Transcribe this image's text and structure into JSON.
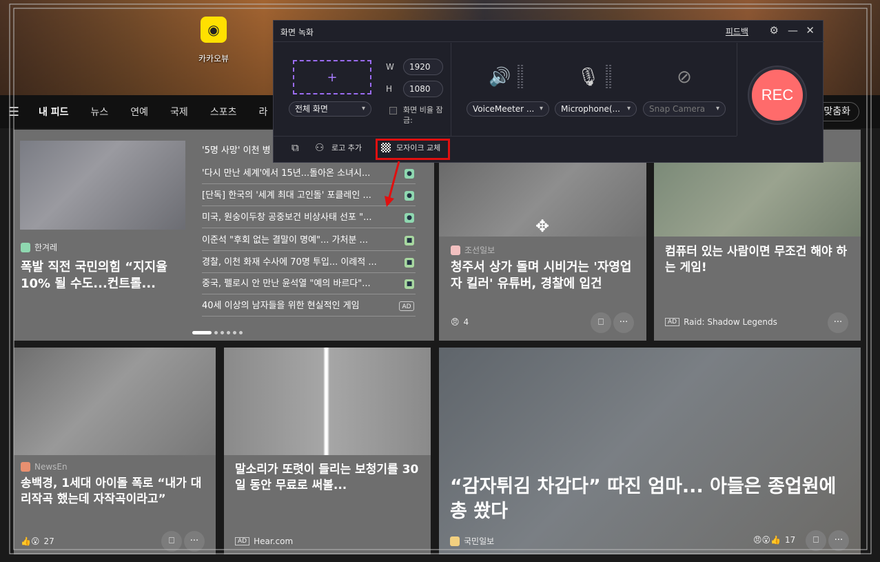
{
  "desktop": {
    "icons": [
      {
        "label": "카카오뷰"
      }
    ]
  },
  "nav": {
    "items": [
      "내 피드",
      "뉴스",
      "연예",
      "국제",
      "스포츠",
      "라"
    ],
    "right_button": "맞춤화"
  },
  "feed": {
    "card1": {
      "source": "한겨레",
      "headline": "폭발 직전 국민의힘 “지지율 10% 될 수도...컨트롤..."
    },
    "list": [
      {
        "text": "'5명 사망' 이천 병",
        "tag": ""
      },
      {
        "text": "'다시 만난 세계'에서 15년...돌아온 소녀시...",
        "tag": "h"
      },
      {
        "text": "[단독] 한국의 '세계 최대 고인돌' 포클레인 ...",
        "tag": "h"
      },
      {
        "text": "미국, 원숭이두창 공중보건 비상사태 선포 \"...",
        "tag": "h"
      },
      {
        "text": "이준석 \"후회 없는 결말이 명예\"... 가처분 ...",
        "tag": "g"
      },
      {
        "text": "경찰, 이천 화재 수사에 70명 투입... 이례적 ...",
        "tag": "g"
      },
      {
        "text": "중국, 펠로시 안 만난 윤석열 \"예의 바르다\"...",
        "tag": "g"
      },
      {
        "text": "40세 이상의 남자들을 위한 현실적인 게임",
        "tag": "AD"
      }
    ],
    "card_chosun": {
      "source": "조선일보",
      "headline": "청주서 상가 돌며 시비거는 '자영업자 킬러' 유튜버, 경찰에 입건",
      "reactions": "4"
    },
    "card_ad_game": {
      "headline": "컴퓨터 있는 사람이면 무조건 해야 하는 게임!",
      "ad_label": "AD",
      "source": "Raid: Shadow Legends"
    },
    "card_newsen": {
      "source": "NewsEn",
      "headline": "송백경, 1세대 아이돌 폭로 “내가 대리작곡 했는데 자작곡이라고”",
      "reactions": "27"
    },
    "card_hear": {
      "headline": "말소리가 또렷이 들리는 보청기를 30일 동안 무료로 써볼...",
      "ad_label": "AD",
      "source": "Hear.com"
    },
    "card_kukmin": {
      "headline": "“감자튀김 차갑다” 따진 엄마... 아들은 종업원에 총 쐈다",
      "source": "국민일보",
      "reactions": "17"
    },
    "bookmark_icon": "bookmark-icon",
    "more_label": "···"
  },
  "recorder": {
    "title": "화면 녹화",
    "feedback": "피드백",
    "region_plus": "+",
    "w_label": "W",
    "h_label": "H",
    "width": "1920",
    "height": "1080",
    "mode": "전체 화면",
    "lock_ratio": "화면 비율 잠금:",
    "speaker": "VoiceMeeter ...",
    "microphone": "Microphone(...",
    "camera": "Snap Camera",
    "rec": "REC",
    "logo_add": "로고 추가",
    "mosaic": "모자이크 교체",
    "highlight_color": "#e01010",
    "rec_color": "#ff6b6b"
  }
}
